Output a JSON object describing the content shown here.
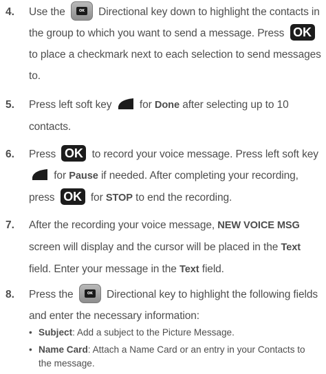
{
  "ok_label": "OK",
  "dir_key_label": "OK",
  "steps": [
    {
      "num": "4.",
      "a": "Use the",
      "b": "Directional key down to highlight the contacts in the group to which you want to send a message. Press",
      "c": "to place a checkmark next to each selection to send messages to."
    },
    {
      "num": "5.",
      "a": "Press left soft key",
      "b": "for",
      "bold": "Done",
      "c": "after selecting up to 10 contacts."
    },
    {
      "num": "6.",
      "a": "Press",
      "b": "to record your voice message. Press left soft key",
      "c": "for",
      "bold1": "Pause",
      "d": "if needed. After completing your recording, press",
      "e": "for",
      "bold2": "STOP",
      "f": "to end the recording."
    },
    {
      "num": "7.",
      "a": "After the recording your voice message,",
      "bold1": "NEW VOICE MSG",
      "b": "screen will display and the cursor will be placed in the",
      "bold2": "Text",
      "c": "field. Enter your message in the",
      "bold3": "Text",
      "d": "field."
    },
    {
      "num": "8.",
      "a": "Press the",
      "b": "Directional key to highlight the following fields and enter the necessary information:"
    }
  ],
  "bullets": [
    {
      "dot": "•",
      "term": "Subject",
      "text": ": Add a subject to the Picture Message."
    },
    {
      "dot": "•",
      "term": "Name Card",
      "text": ": Attach a Name Card or an entry in your Contacts to the message."
    }
  ]
}
